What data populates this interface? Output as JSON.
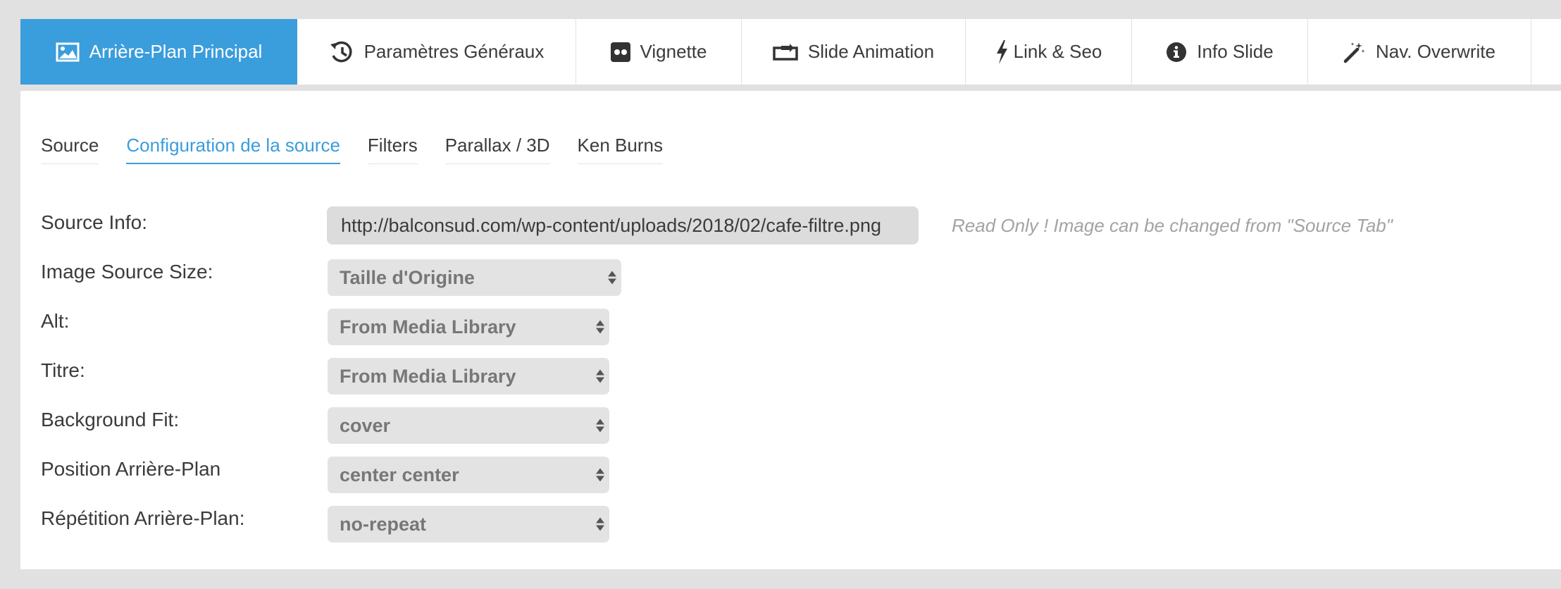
{
  "tabs": [
    {
      "label": "Arrière-Plan Principal",
      "icon": "image-icon",
      "active": true
    },
    {
      "label": "Paramètres Généraux",
      "icon": "history-icon",
      "active": false
    },
    {
      "label": "Vignette",
      "icon": "flickr-icon",
      "active": false
    },
    {
      "label": "Slide Animation",
      "icon": "transition-icon",
      "active": false
    },
    {
      "label": "Link & Seo",
      "icon": "bolt-icon",
      "active": false
    },
    {
      "label": "Info Slide",
      "icon": "info-icon",
      "active": false
    },
    {
      "label": "Nav. Overwrite",
      "icon": "magic-wand-icon",
      "active": false
    }
  ],
  "subtabs": [
    {
      "label": "Source",
      "active": false
    },
    {
      "label": "Configuration de la source",
      "active": true
    },
    {
      "label": "Filters",
      "active": false
    },
    {
      "label": "Parallax / 3D",
      "active": false
    },
    {
      "label": "Ken Burns",
      "active": false
    }
  ],
  "source_info": {
    "label": "Source Info:",
    "value": "http://balconsud.com/wp-content/uploads/2018/02/cafe-filtre.png",
    "hint": "Read Only ! Image can be changed from \"Source Tab\""
  },
  "fields": [
    {
      "label": "Image Source Size:",
      "value": "Taille d'Origine"
    },
    {
      "label": "Alt:",
      "value": "From Media Library"
    },
    {
      "label": "Titre:",
      "value": "From Media Library"
    },
    {
      "label": "Background Fit:",
      "value": "cover"
    },
    {
      "label": "Position Arrière-Plan",
      "value": "center center"
    },
    {
      "label": "Répétition Arrière-Plan:",
      "value": "no-repeat"
    }
  ],
  "colors": {
    "accent": "#3a9ddc",
    "background": "#e1e1e1",
    "panel": "#ffffff"
  }
}
